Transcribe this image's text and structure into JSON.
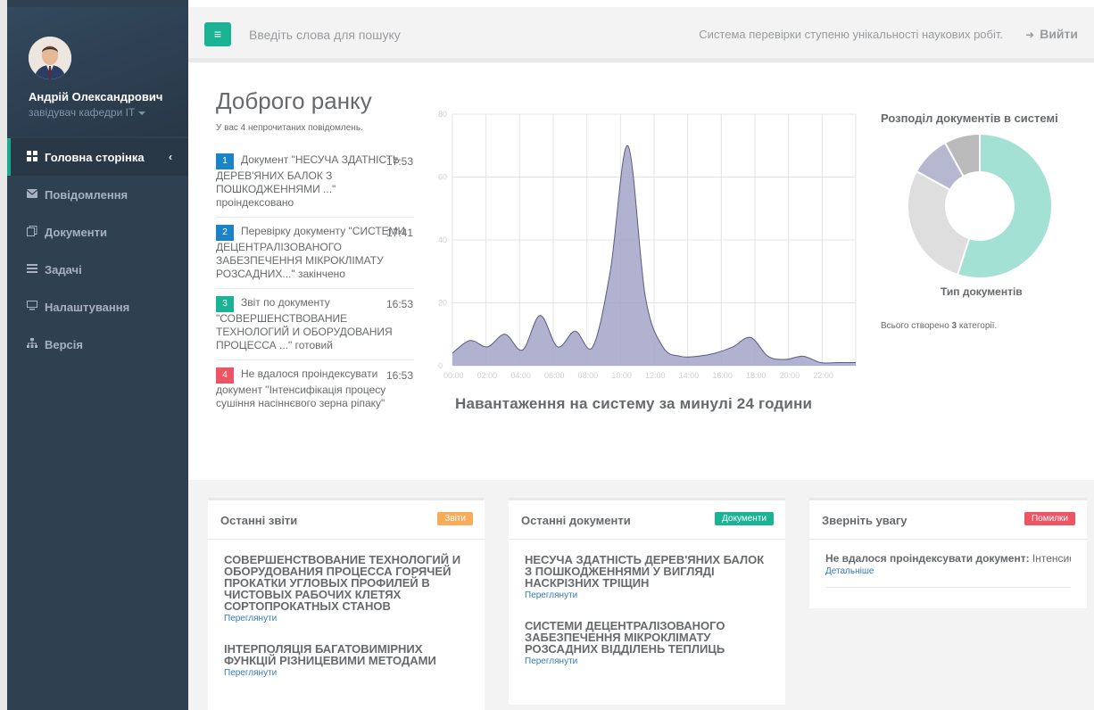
{
  "user": {
    "name": "Андрій Олександрович",
    "role": "завідувач кафедри IT"
  },
  "nav": {
    "items": [
      {
        "label": "Головна сторінка",
        "icon": "grid-icon",
        "active": true
      },
      {
        "label": "Повідомлення",
        "icon": "envelope-icon",
        "active": false
      },
      {
        "label": "Документи",
        "icon": "documents-icon",
        "active": false
      },
      {
        "label": "Задачі",
        "icon": "tasks-icon",
        "active": false
      },
      {
        "label": "Налаштування",
        "icon": "monitor-icon",
        "active": false
      },
      {
        "label": "Версія",
        "icon": "sitemap-icon",
        "active": false
      }
    ]
  },
  "topbar": {
    "search_placeholder": "Введіть слова для пошуку",
    "system_info": "Система перевірки ступеню унікальності наукових робіт.",
    "logout_label": "Вийти"
  },
  "welcome": {
    "greeting": "Доброго ранку",
    "unread": "У вас 4 непрочитаних повідомлень."
  },
  "messages": [
    {
      "num": "1",
      "color": "#1c84c6",
      "time": "17:53",
      "text": "Документ \"НЕСУЧА ЗДАТНІСТЬ ДЕРЕВ'ЯНИХ БАЛОК З ПОШКОДЖЕННЯМИ ...\" проіндексовано"
    },
    {
      "num": "2",
      "color": "#1c84c6",
      "time": "17:41",
      "text": "Перевірку документу \"СИСТЕМИ ДЕЦЕНТРАЛІЗОВАНОГО ЗАБЕЗПЕЧЕННЯ МІКРОКЛІМАТУ РОЗСАДНИХ...\" закінчено"
    },
    {
      "num": "3",
      "color": "#1ab394",
      "time": "16:53",
      "text": "Звіт по документу \"СОВЕРШЕНСТВОВАНИЕ ТЕХНОЛОГИЙ И ОБОРУДОВАНИЯ ПРОЦЕССА ...\" готовий"
    },
    {
      "num": "4",
      "color": "#ed5565",
      "time": "16:53",
      "text": "Не вдалося проіндексувати документ \"Інтенсифікація процесу сушіння насіннєвого зерна ріпаку\""
    }
  ],
  "chart_data": [
    {
      "type": "area",
      "title": "Навантаження на систему за минулі 24 години",
      "x": [
        "00:00",
        "01:00",
        "02:00",
        "03:00",
        "04:00",
        "05:00",
        "06:00",
        "07:00",
        "08:00",
        "09:00",
        "10:00",
        "11:00",
        "12:00",
        "13:00",
        "14:00",
        "15:00",
        "16:00",
        "17:00",
        "18:00",
        "19:00",
        "20:00",
        "21:00",
        "22:00",
        "23:00"
      ],
      "values": [
        4,
        8,
        6,
        10,
        5,
        16,
        6,
        11,
        6,
        30,
        70,
        22,
        6,
        3,
        3,
        4,
        6,
        9,
        3,
        2,
        3,
        1,
        1,
        1
      ],
      "yticks": [
        0,
        20,
        40,
        60,
        80
      ],
      "xticks": [
        "00:00",
        "02:00",
        "04:00",
        "06:00",
        "08:00",
        "10:00",
        "12:00",
        "14:00",
        "16:00",
        "18:00",
        "20:00",
        "22:00"
      ],
      "ylim": [
        0,
        80
      ],
      "grid": true,
      "fill_color": "#a3a3c8",
      "line_color": "#5a5a84"
    },
    {
      "type": "pie",
      "title": "Розподіл документів в системі",
      "xlabel": "Тип документів",
      "values": [
        55,
        28,
        9,
        8
      ],
      "colors": [
        "#a3e1d4",
        "#dedede",
        "#b5b8cf",
        "#bababa"
      ]
    }
  ],
  "donut_note": {
    "prefix": "Всього створено ",
    "count": "3",
    "suffix": " категорії."
  },
  "panels": {
    "reports": {
      "title": "Останні звіти",
      "badge": "Звіти",
      "badge_color": "#f8ac59",
      "items": [
        {
          "title": "СОВЕРШЕНСТВОВАНИЕ ТЕХНОЛОГИЙ И ОБОРУДОВАНИЯ ПРОЦЕССА ГОРЯЧЕЙ ПРОКАТКИ УГЛОВЫХ ПРОФИЛЕЙ В ЧИСТОВЫХ РАБОЧИХ КЛЕТЯХ СОРТОПРОКАТНЫХ СТАНОВ",
          "link": "Переглянути"
        },
        {
          "title": "ІНТЕРПОЛЯЦІЯ БАГАТОВИМІРНИХ ФУНКЦІЙ РІЗНИЦЕВИМИ МЕТОДАМИ",
          "link": "Переглянути"
        }
      ]
    },
    "documents": {
      "title": "Останні документи",
      "badge": "Документи",
      "badge_color": "#1ab394",
      "items": [
        {
          "title": "НЕСУЧА ЗДАТНІСТЬ ДЕРЕВ'ЯНИХ БАЛОК З ПОШКОДЖЕННЯМИ У ВИГЛЯДІ НАСКРІЗНИХ ТРІЩИН",
          "link": "Переглянути"
        },
        {
          "title": "СИСТЕМИ ДЕЦЕНТРАЛІЗОВАНОГО ЗАБЕЗПЕЧЕННЯ МІКРОКЛІМАТУ РОЗСАДНИХ ВІДДІЛЕНЬ ТЕПЛИЦЬ",
          "link": "Переглянути"
        }
      ]
    },
    "alerts": {
      "title": "Зверніть увагу",
      "badge": "Помилки",
      "badge_color": "#ed5565",
      "items": [
        {
          "bold": "Не вдалося проіндексувати документ:",
          "text": " Інтенсиф",
          "link": "Детальніше"
        }
      ]
    }
  }
}
